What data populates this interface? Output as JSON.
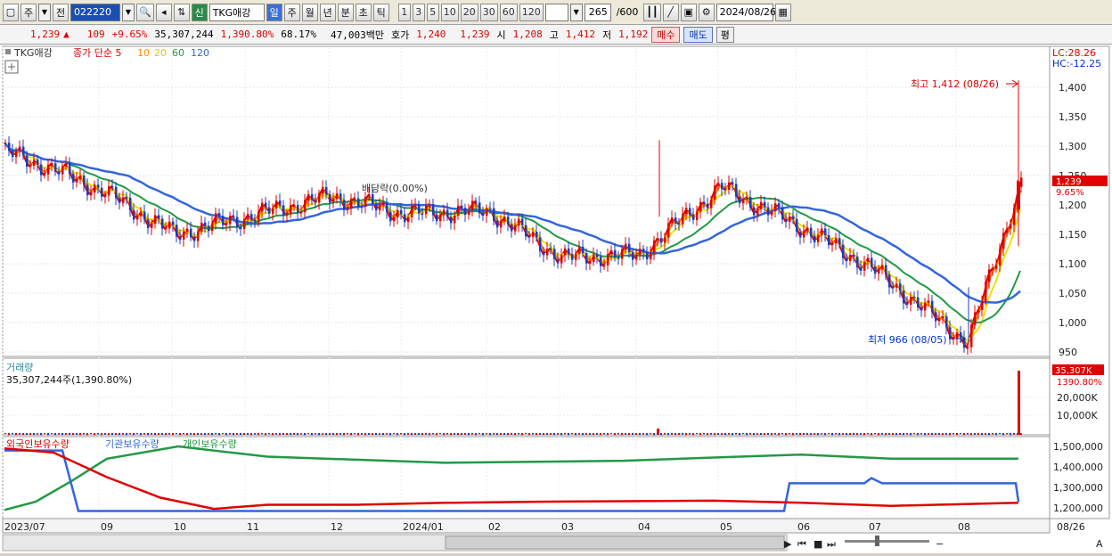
{
  "toolbar": {
    "market_label": "주",
    "prev_label": "전",
    "code": "022220",
    "name_badge": "신",
    "stock_name": "TKG애강",
    "periods": [
      "일",
      "주",
      "월",
      "년",
      "분",
      "초",
      "틱"
    ],
    "numbers": [
      "1",
      "3",
      "5",
      "10",
      "20",
      "30",
      "60",
      "120"
    ],
    "count": "265",
    "count_total": "/600",
    "date": "2024/08/26"
  },
  "info": {
    "price": "1,239",
    "arrow": "▲",
    "change": "109",
    "change_pct": "+9.65%",
    "volume": "35,307,244",
    "volume_pct": "1,390.80%",
    "ratio": "68.17%",
    "amount": "47,003백만",
    "bid_label": "호가",
    "bid1": "1,240",
    "bid2": "1,239",
    "open_label": "시",
    "open": "1,208",
    "high_label": "고",
    "high": "1,412",
    "low_label": "저",
    "low": "1,192",
    "buy_label": "매수",
    "sell_label": "매도",
    "flat_label": "평"
  },
  "price_panel": {
    "legend_name": "TKG애강",
    "legend_ma": "종가 단순 5",
    "ma_periods": [
      "10",
      "20",
      "60",
      "120"
    ],
    "lc": "LC:28.26",
    "hc": "HC:-12.25",
    "high_note": "최고 1,412 (08/26)",
    "low_note": "최저 966 (08/05)",
    "dividend_note": "배당락(0.00%)",
    "current_tag": "1,239",
    "current_pct": "9.65%",
    "y_ticks": [
      "1,400",
      "1,350",
      "1,300",
      "1,250",
      "1,200",
      "1,150",
      "1,100",
      "1,050",
      "1,000",
      "950"
    ]
  },
  "volume_panel": {
    "title": "거래량",
    "value": "35,307,244주(1,390.80%)",
    "tag": "35,307K",
    "tag_pct": "1390.80%",
    "y_ticks": [
      "20,000K",
      "10,000K"
    ]
  },
  "holdings_panel": {
    "legend": [
      "외국인보유수량",
      "기관보유수량",
      "개인보유수량"
    ],
    "y_ticks": [
      "1,500,000",
      "1,400,000",
      "1,300,000",
      "1,200,000"
    ]
  },
  "x_axis": [
    "2023/07",
    "09",
    "10",
    "11",
    "12",
    "2024/01",
    "02",
    "03",
    "04",
    "05",
    "06",
    "07",
    "08",
    "08/26"
  ],
  "colors": {
    "up": "#e00000",
    "down": "#1a3cc8",
    "ma5": "#e00000",
    "ma10": "#ff8c00",
    "ma20": "#f0e000",
    "ma60": "#229944",
    "ma120": "#3366dd",
    "foreign": "#e00000",
    "institution": "#3366dd",
    "individual": "#229944"
  },
  "chart_data": {
    "type": "line",
    "title": "TKG애강",
    "series": [
      {
        "name": "종가",
        "x": [
          "2023/07",
          "08",
          "09",
          "10",
          "11",
          "12",
          "2024/01",
          "02",
          "03",
          "04",
          "05",
          "06",
          "07",
          "08/05",
          "08/26"
        ],
        "values": [
          1290,
          1260,
          1225,
          1150,
          1180,
          1215,
          1185,
          1190,
          1110,
          1115,
          1230,
          1165,
          1095,
          966,
          1239
        ]
      }
    ],
    "high": {
      "value": 1412,
      "date": "08/26"
    },
    "low": {
      "value": 966,
      "date": "08/05"
    },
    "ylim": [
      930,
      1440
    ]
  }
}
